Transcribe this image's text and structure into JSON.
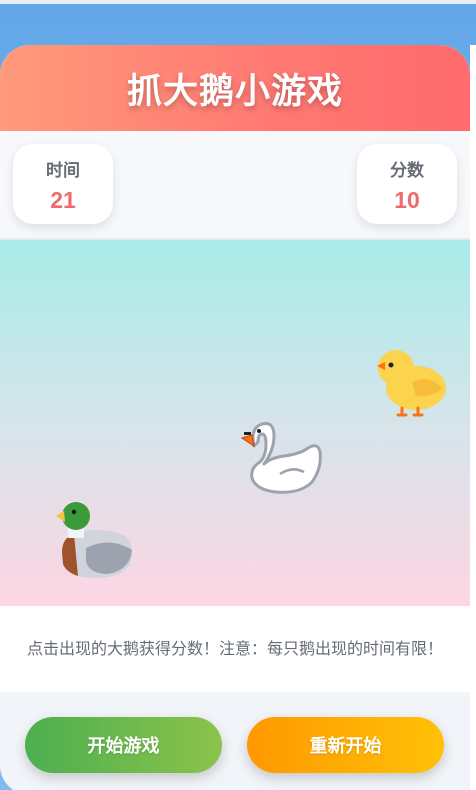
{
  "game": {
    "title": "抓大鹅小游戏"
  },
  "stats": {
    "time_label": "时间",
    "time_value": "21",
    "score_label": "分数",
    "score_value": "10"
  },
  "play_area": {
    "entities": [
      "duck-icon",
      "goose-icon",
      "chick-icon"
    ]
  },
  "hint": {
    "text": "点击出现的大鹅获得分数！注意：每只鹅出现的时间有限！"
  },
  "controls": {
    "start_label": "开始游戏",
    "reset_label": "重新开始"
  },
  "colors": {
    "header_start": "#ff9a7a",
    "header_end": "#ff6b6e",
    "stat_value": "#ef6b6b",
    "start_button": "#4caf50",
    "reset_button": "#ff9800"
  }
}
